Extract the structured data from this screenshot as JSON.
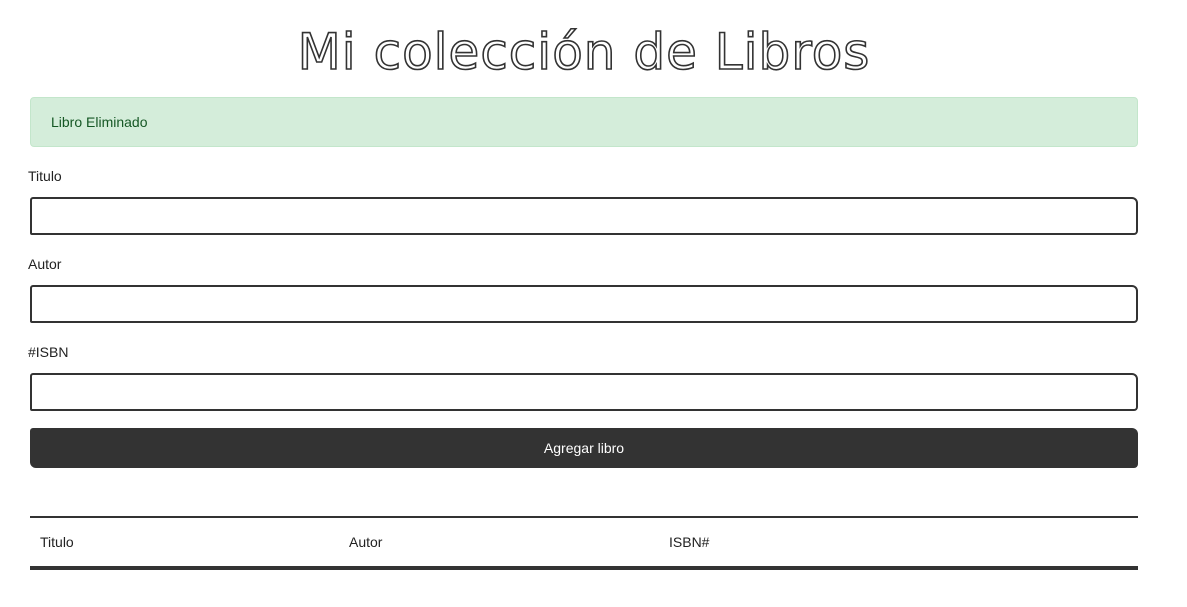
{
  "header": {
    "title": "Mi colección de Libros"
  },
  "alert": {
    "message": "Libro Eliminado"
  },
  "form": {
    "title_label": "Titulo",
    "title_value": "",
    "author_label": "Autor",
    "author_value": "",
    "isbn_label": "#ISBN",
    "isbn_value": "",
    "submit_label": "Agregar libro"
  },
  "table": {
    "columns": [
      "Titulo",
      "Autor",
      "ISBN#",
      ""
    ],
    "rows": []
  },
  "colors": {
    "alert_bg": "#d4edda",
    "alert_text": "#155724",
    "button_bg": "#333333",
    "button_text": "#ffffff"
  }
}
